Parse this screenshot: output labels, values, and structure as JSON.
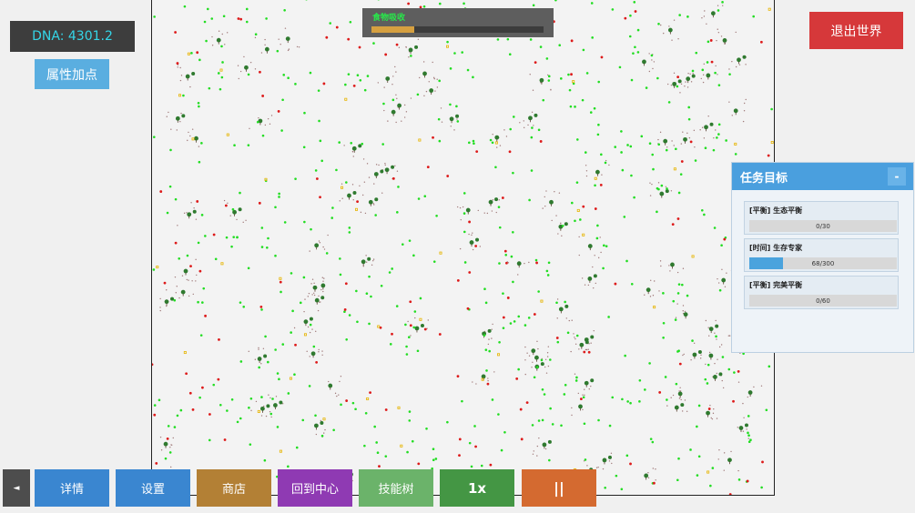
{
  "hud": {
    "dna_text": "DNA: 4301.2",
    "attribute_button": "属性加点",
    "exit_button": "退出世界"
  },
  "absorb": {
    "label": "食物吸收",
    "progress": 0.25
  },
  "quests": {
    "title": "任务目标",
    "collapse_label": "-",
    "items": [
      {
        "title": "[平衡] 生态平衡",
        "progress_text": "0/30",
        "progress": 0.0
      },
      {
        "title": "[时间] 生存专家",
        "progress_text": "68/300",
        "progress": 0.227
      },
      {
        "title": "[平衡] 完美平衡",
        "progress_text": "0/60",
        "progress": 0.0
      }
    ]
  },
  "toolbar": {
    "collapse_label": "◄",
    "details": "详情",
    "settings": "设置",
    "shop": "商店",
    "center": "回到中心",
    "skills": "技能树",
    "speed": "1x",
    "pause": "||"
  },
  "colors": {
    "food_green": "#22dd22",
    "predator_red": "#dd1a1a",
    "tree": "#2f7a2f",
    "yellow_item": "#e6b400",
    "accent_blue": "#4a9fde"
  }
}
